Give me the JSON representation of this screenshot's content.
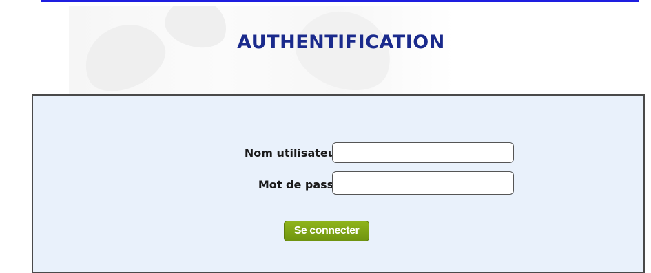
{
  "page": {
    "title": "AUTHENTIFICATION"
  },
  "login_form": {
    "username_label": "Nom utilisateur :",
    "password_label": "Mot de passe :",
    "username_value": "",
    "password_value": "",
    "submit_label": "Se connecter"
  },
  "colors": {
    "title": "#1a2a8c",
    "panel_background": "#e9f1fb",
    "button": "#7fa316",
    "top_rule": "#1e1ee0"
  }
}
